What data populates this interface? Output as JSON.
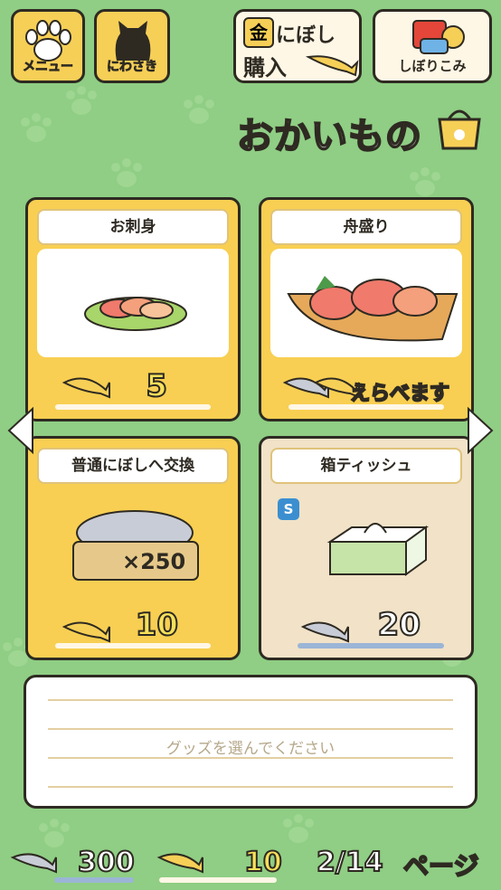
{
  "header": {
    "menu_label": "メニュー",
    "niwasaki_label": "にわさき",
    "buy_line1": "にぼし",
    "buy_line2": "購入",
    "buy_badge": "金",
    "shibori_label": "しぼりこみ",
    "title": "おかいもの"
  },
  "items": [
    {
      "name": "お刺身",
      "price": "5",
      "currency": "gold-niboshi"
    },
    {
      "name": "舟盛り",
      "price": "えらべます",
      "currency": "both"
    },
    {
      "name": "普通にぼしへ交換",
      "price": "10",
      "currency": "gold-niboshi",
      "crate_label": "×250"
    },
    {
      "name": "箱ティッシュ",
      "price": "20",
      "currency": "niboshi",
      "badge": "S"
    }
  ],
  "message": "グッズを選んでください",
  "footer": {
    "niboshi": "300",
    "gold_niboshi": "10",
    "page": "2/14",
    "page_label": "ページ"
  },
  "colors": {
    "background": "#8fce84",
    "card_yellow": "#f8cf52",
    "card_disabled": "#f1e2c8",
    "outline": "#2e2a22"
  }
}
